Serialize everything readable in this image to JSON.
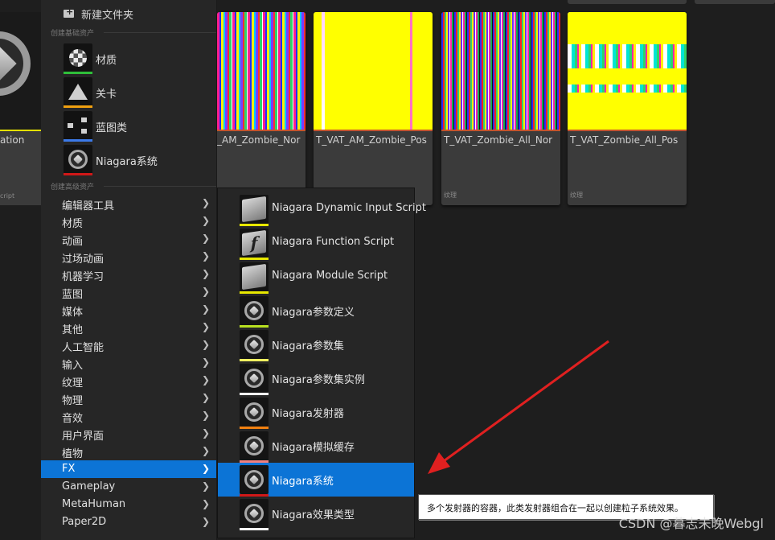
{
  "background_tiles": [
    {
      "name": "ation",
      "type": "cript"
    },
    {
      "name": "_AM_Zombie_Nor",
      "type": ""
    },
    {
      "name": "T_VAT_AM_Zombie_Pos",
      "type": ""
    },
    {
      "name": "T_VAT_Zombie_All_Nor",
      "type": "纹理"
    },
    {
      "name": "T_VAT_Zombie_All_Pos",
      "type": "纹理"
    }
  ],
  "menu": {
    "new_folder": "新建文件夹",
    "basic_section": "创建基础资产",
    "basic_items": [
      {
        "label": "材质",
        "color": "#2fbf3a"
      },
      {
        "label": "关卡",
        "color": "#f0a010"
      },
      {
        "label": "蓝图类",
        "color": "#3c7ae8"
      },
      {
        "label": "Niagara系统",
        "color": "#d01818"
      }
    ],
    "advanced_section": "创建高级资产",
    "categories": [
      "编辑器工具",
      "材质",
      "动画",
      "过场动画",
      "机器学习",
      "蓝图",
      "媒体",
      "其他",
      "人工智能",
      "输入",
      "纹理",
      "物理",
      "音效",
      "用户界面",
      "植物",
      "FX",
      "Gameplay",
      "MetaHuman",
      "Paper2D"
    ],
    "selected_category": "FX"
  },
  "submenu": {
    "items": [
      {
        "label": "Niagara Dynamic Input Script",
        "color": "#e8e800",
        "icon": "script"
      },
      {
        "label": "Niagara Function Script",
        "color": "#e8e800",
        "icon": "script-f"
      },
      {
        "label": "Niagara Module Script",
        "color": "#e8e800",
        "icon": "script"
      },
      {
        "label": "Niagara参数定义",
        "color": "#b8e020",
        "icon": "orb"
      },
      {
        "label": "Niagara参数集",
        "color": "#f0f060",
        "icon": "orb"
      },
      {
        "label": "Niagara参数集实例",
        "color": "#ffffff",
        "icon": "orb"
      },
      {
        "label": "Niagara发射器",
        "color": "#f08010",
        "icon": "orb"
      },
      {
        "label": "Niagara模拟缓存",
        "color": "#f08080",
        "icon": "orb"
      },
      {
        "label": "Niagara系统",
        "color": "#d01818",
        "icon": "orb"
      },
      {
        "label": "Niagara效果类型",
        "color": "#ffffff",
        "icon": "orb"
      }
    ],
    "selected": "Niagara系统"
  },
  "tooltip": "多个发射器的容器，此类发射器组合在一起以创建粒子系统效果。",
  "watermark": "CSDN @暮志未晚Webgl",
  "arrow_color": "#e02020"
}
